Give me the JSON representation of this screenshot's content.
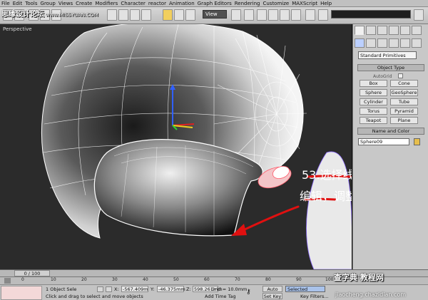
{
  "watermark": {
    "text": "思缘设计论坛",
    "sub": "www.MISSYUAN.COM"
  },
  "menu": [
    "File",
    "Edit",
    "Tools",
    "Group",
    "Views",
    "Create",
    "Modifiers",
    "Character",
    "reactor",
    "Animation",
    "Graph Editors",
    "Rendering",
    "Customize",
    "MAXScript",
    "Help"
  ],
  "toolbar": {
    "view": "View"
  },
  "viewport": {
    "label": "Perspective",
    "annotation_line1": "53.选择线   在进行",
    "annotation_line2": "编辑，调整位置，",
    "colors": {
      "annotation_stroke": "#e01010",
      "selected_edge": "#ff5a6a"
    }
  },
  "command_panel": {
    "dropdown": "Standard Primitives",
    "object_type_title": "Object Type",
    "autogrid": "AutoGrid",
    "buttons": [
      "Box",
      "Cone",
      "Sphere",
      "GeoSphere",
      "Cylinder",
      "Tube",
      "Torus",
      "Pyramid",
      "Teapot",
      "Plane"
    ],
    "name_color_title": "Name and Color",
    "object_name": "Sphere09"
  },
  "timeline": {
    "frame": "0 / 100",
    "ticks": [
      "0",
      "10",
      "20",
      "30",
      "40",
      "50",
      "60",
      "70",
      "80",
      "90",
      "100"
    ]
  },
  "status": {
    "selection": "1 Object Sele",
    "prompt": "Click and drag to select and move objects",
    "x_label": "X:",
    "x_value": "-567.409m",
    "y_label": "Y:",
    "y_value": "-46.375mm",
    "z_label": "Z:",
    "z_value": "598.261mm",
    "grid": "Grid = 10.0mm",
    "add_time_tag": "Add Time Tag",
    "auto_key": "Auto Key",
    "selected": "Selected",
    "set_key": "Set Key",
    "key_filters": "Key Filters..."
  },
  "site_watermark": {
    "line1": "查字典 教程网",
    "line2": "jiaocheng.chazidian.com"
  }
}
